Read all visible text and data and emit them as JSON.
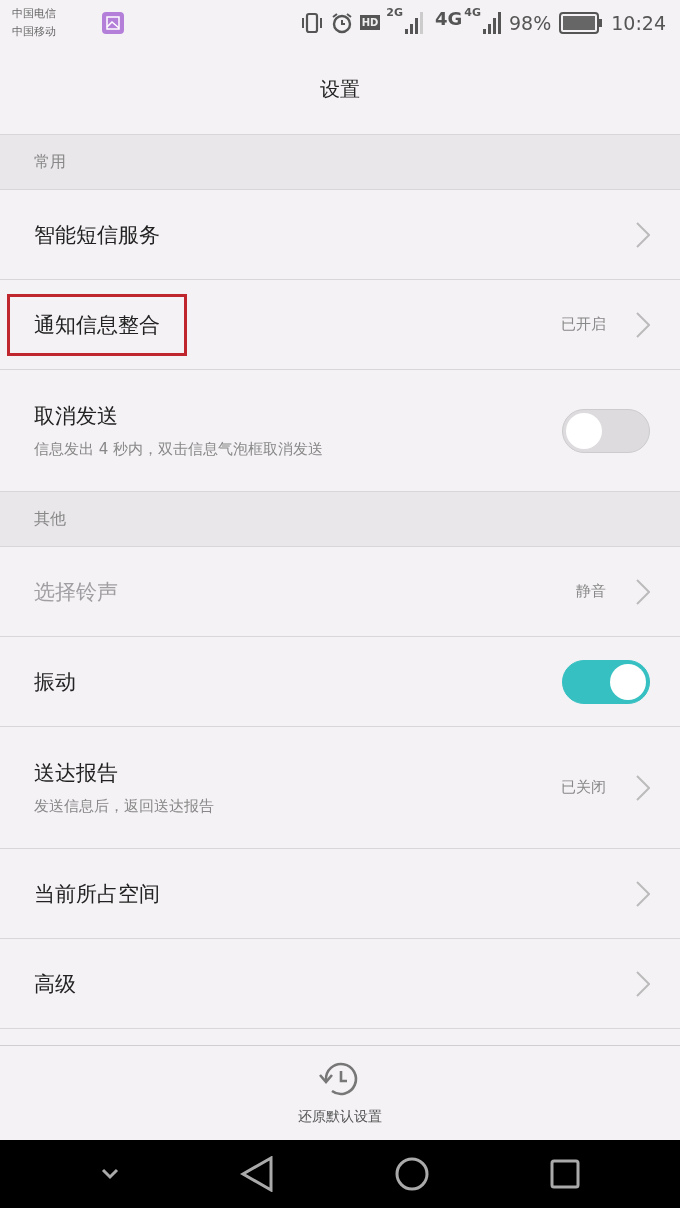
{
  "status_bar": {
    "carriers": [
      "中国电信",
      "中国移动"
    ],
    "network_1": "2G",
    "hd": "HD",
    "network_2": "4G",
    "network_3": "4G",
    "battery": "98%",
    "time": "10:24"
  },
  "header": {
    "title": "设置"
  },
  "sections": [
    {
      "title": "常用",
      "items": [
        {
          "kind": "link",
          "label": "智能短信服务",
          "disabled": false,
          "highlighted": false
        },
        {
          "kind": "link",
          "label": "通知信息整合",
          "value": "已开启",
          "disabled": false,
          "highlighted": true
        },
        {
          "kind": "toggle",
          "label": "取消发送",
          "subtitle": "信息发出 4 秒内，双击信息气泡框取消发送",
          "on": false,
          "disabled": false,
          "highlighted": false
        }
      ]
    },
    {
      "title": "其他",
      "items": [
        {
          "kind": "link",
          "label": "选择铃声",
          "value": "静音",
          "disabled": true,
          "highlighted": false
        },
        {
          "kind": "toggle",
          "label": "振动",
          "on": true,
          "disabled": false,
          "highlighted": false
        },
        {
          "kind": "link",
          "label": "送达报告",
          "subtitle": "发送信息后，返回送达报告",
          "value": "已关闭",
          "disabled": false,
          "highlighted": false
        },
        {
          "kind": "link",
          "label": "当前所占空间",
          "disabled": false,
          "highlighted": false
        },
        {
          "kind": "link",
          "label": "高级",
          "disabled": false,
          "highlighted": false
        }
      ]
    }
  ],
  "footer": {
    "action": "还原默认设置"
  }
}
